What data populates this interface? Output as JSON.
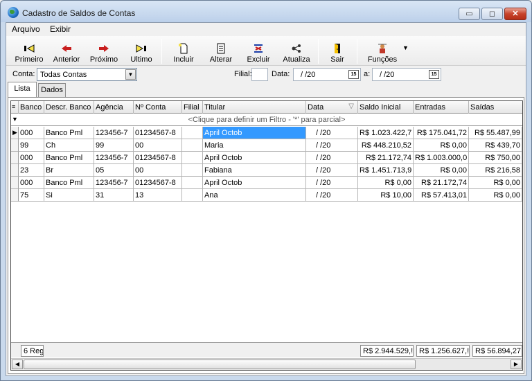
{
  "window": {
    "title": "Cadastro de Saldos de Contas",
    "min_glyph": "▭",
    "max_glyph": "◻",
    "close_glyph": "✕"
  },
  "menu": [
    "Arquivo",
    "Exibir"
  ],
  "toolbar": [
    {
      "label": "Primeiro",
      "icon": "first-record-icon"
    },
    {
      "label": "Anterior",
      "icon": "previous-arrow-icon"
    },
    {
      "label": "Próximo",
      "icon": "next-arrow-icon"
    },
    {
      "label": "Ultimo",
      "icon": "last-record-icon"
    },
    {
      "label": "Incluir",
      "icon": "new-document-icon"
    },
    {
      "label": "Alterar",
      "icon": "edit-document-icon"
    },
    {
      "label": "Excluir",
      "icon": "delete-icon"
    },
    {
      "label": "Atualiza",
      "icon": "refresh-icon"
    },
    {
      "label": "Sair",
      "icon": "exit-door-icon"
    },
    {
      "label": "Funções",
      "icon": "functions-icon"
    }
  ],
  "filter": {
    "conta_label": "Conta:",
    "conta_value": "Todas Contas",
    "filial_label": "Filial:",
    "filial_value": "",
    "data_label": "Data:",
    "data_from": "/   /20",
    "a_label": "a:",
    "data_to": "/   /20",
    "cal_glyph": "15"
  },
  "tabs": [
    {
      "label": "Lista",
      "active": true
    },
    {
      "label": "Dados",
      "active": false
    }
  ],
  "grid": {
    "columns": [
      "Banco",
      "Descr. Banco",
      "Agência",
      "Nº Conta",
      "Filial",
      "Titular",
      "Data",
      "Saldo Inicial",
      "Entradas",
      "Saídas"
    ],
    "filter_hint": "<Clique para definir um Filtro - '*' para parcial>",
    "rows": [
      [
        "000",
        "Banco Pml",
        "123456-7",
        "01234567-8",
        "",
        "April Octob",
        "/   /20",
        "R$ 1.023.422,7",
        "R$ 175.041,72",
        "R$ 55.487,99"
      ],
      [
        "99",
        "Ch",
        "99",
        "00",
        "",
        "Maria",
        "/   /20",
        "R$ 448.210,52",
        "R$ 0,00",
        "R$ 439,70"
      ],
      [
        "000",
        "Banco Pml",
        "123456-7",
        "01234567-8",
        "",
        "April Octob",
        "/   /20",
        "R$ 21.172,74",
        "R$ 1.003.000,0",
        "R$ 750,00"
      ],
      [
        "23",
        "Br",
        "05",
        "00",
        "",
        "Fabiana",
        "/   /20",
        "R$ 1.451.713,9",
        "R$ 0,00",
        "R$ 216,58"
      ],
      [
        "000",
        "Banco Pml",
        "123456-7",
        "01234567-8",
        "",
        "April Octob",
        "/   /20",
        "R$ 0,00",
        "R$ 21.172,74",
        "R$ 0,00"
      ],
      [
        "75",
        "Si",
        "31",
        "13",
        "",
        "Ana",
        "/   /20",
        "R$ 10,00",
        "R$ 57.413,01",
        "R$ 0,00"
      ]
    ],
    "footer": {
      "count": "6 Reg",
      "saldo_total": "R$ 2.944.529,!",
      "entradas_total": "R$ 1.256.627,!",
      "saidas_total": "R$ 56.894,27"
    }
  }
}
